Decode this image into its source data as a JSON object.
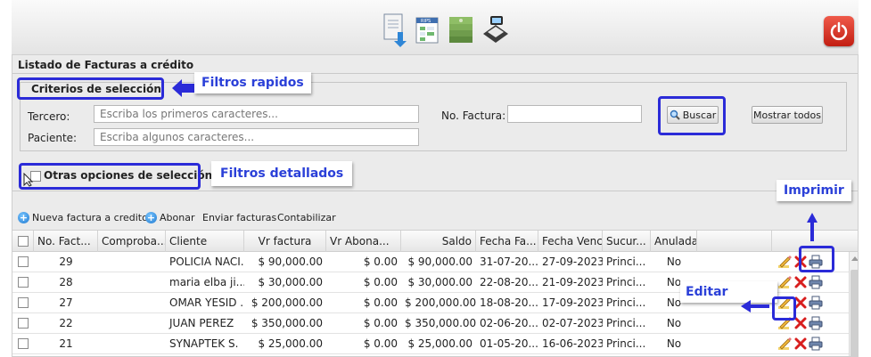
{
  "panel": {
    "title": "Listado de Facturas a crédito"
  },
  "criterios": {
    "legend": "Criterios de selección",
    "tercero_label": "Tercero:",
    "tercero_placeholder": "Escriba los primeros caracteres...",
    "paciente_label": "Paciente:",
    "paciente_placeholder": "Escriba algunos caracteres...",
    "factura_label": "No. Factura:",
    "factura_value": "",
    "buscar_label": "Buscar",
    "mostrar_label": "Mostrar todos"
  },
  "otras_opciones": {
    "label": "Otras opciones de selección"
  },
  "callouts": {
    "filtros_rapidos": "Filtros rapidos",
    "filtros_detallados": "Filtros detallados",
    "imprimir": "Imprimir",
    "editar": "Editar"
  },
  "toolbar": {
    "nueva": "Nueva factura a credito",
    "abonar": "Abonar",
    "enviar": "Enviar facturas",
    "contabilizar": "Contabilizar"
  },
  "grid": {
    "columns": [
      "No. Fact...",
      "Comproba...",
      "Cliente",
      "Vr factura",
      "Vr Abona...",
      "Saldo",
      "Fecha Fa...",
      "Fecha Venc.",
      "Sucur...",
      "Anulada"
    ],
    "rows": [
      [
        "29",
        "",
        "POLICIA NACI...",
        "$ 90,000.00",
        "$ 0.00",
        "$ 90,000.00",
        "31-07-20...",
        "27-09-2023",
        "Princi...",
        "No"
      ],
      [
        "28",
        "",
        "maria elba ji...",
        "$ 30,000.00",
        "$ 0.00",
        "$ 30,000.00",
        "22-08-20...",
        "21-09-2023",
        "Princi...",
        "No"
      ],
      [
        "27",
        "",
        "OMAR YESID ...",
        "$ 200,000.00",
        "$ 0.00",
        "$ 200,000.00",
        "18-08-20...",
        "17-09-2023",
        "Princi...",
        "No"
      ],
      [
        "22",
        "",
        "JUAN PEREZ",
        "$ 350,000.00",
        "$ 0.00",
        "$ 350,000.00",
        "02-06-20...",
        "02-07-2023",
        "Princi...",
        "No"
      ],
      [
        "21",
        "",
        "SYNAPTEK S.",
        "$ 25,000.00",
        "$ 0.00",
        "$ 25,000.00",
        "01-05-20...",
        "16-06-2023",
        "Princi...",
        "No"
      ]
    ]
  },
  "colors": {
    "highlight": "#2b2bd8",
    "callout_text": "#2b40d8",
    "power": "#d8281c"
  },
  "icons": [
    "import-icon",
    "rips-spreadsheet-icon",
    "money-icon",
    "cash-register-icon",
    "power-icon",
    "search-icon",
    "edit-icon",
    "delete-icon",
    "print-icon"
  ]
}
